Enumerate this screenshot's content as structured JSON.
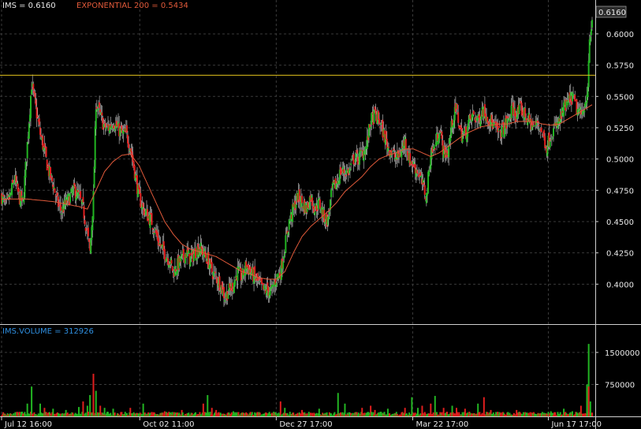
{
  "colors": {
    "background": "#000000",
    "grid": "#3a3a3a",
    "frame": "#d0d0d0",
    "up": "#22b422",
    "down": "#e01e1e",
    "ema": "#e25a3a",
    "resistance": "#e2c21c",
    "price_label": "#e8e8e8",
    "ema_label": "#e25a3a",
    "volume_label": "#2f8fe0"
  },
  "chart_data": [
    {
      "type": "candlestick",
      "labels": {
        "price": "IMS = 0.6160",
        "ema": "EXPONENTIAL 200 = 0.5434",
        "last_price_box": "0.6160"
      },
      "ylim": [
        0.375,
        0.6195
      ],
      "y_ticks": [
        "0.4000",
        "0.4250",
        "0.4500",
        "0.4750",
        "0.5000",
        "0.5250",
        "0.5500",
        "0.5750",
        "0.6000"
      ],
      "x_ticks": [
        "Jul 12 16:00",
        "Oct 02 11:00",
        "Dec 27 17:00",
        "Mar 22 17:00",
        "Jun 17 17:00"
      ],
      "resistance_level": 0.567,
      "price_series": {
        "name": "IMS",
        "close_path": [
          [
            0,
            0.47
          ],
          [
            5,
            0.462
          ],
          [
            10,
            0.47
          ],
          [
            15,
            0.485
          ],
          [
            20,
            0.47
          ],
          [
            25,
            0.465
          ],
          [
            30,
            0.512
          ],
          [
            35,
            0.56
          ],
          [
            40,
            0.54
          ],
          [
            45,
            0.52
          ],
          [
            50,
            0.505
          ],
          [
            55,
            0.49
          ],
          [
            60,
            0.48
          ],
          [
            65,
            0.465
          ],
          [
            70,
            0.458
          ],
          [
            75,
            0.465
          ],
          [
            80,
            0.47
          ],
          [
            85,
            0.475
          ],
          [
            90,
            0.47
          ],
          [
            95,
            0.46
          ],
          [
            100,
            0.44
          ],
          [
            103,
            0.425
          ],
          [
            107,
            0.47
          ],
          [
            110,
            0.545
          ],
          [
            115,
            0.535
          ],
          [
            120,
            0.525
          ],
          [
            125,
            0.525
          ],
          [
            130,
            0.53
          ],
          [
            135,
            0.525
          ],
          [
            140,
            0.52
          ],
          [
            145,
            0.52
          ],
          [
            150,
            0.51
          ],
          [
            155,
            0.49
          ],
          [
            160,
            0.47
          ],
          [
            165,
            0.46
          ],
          [
            170,
            0.455
          ],
          [
            175,
            0.45
          ],
          [
            180,
            0.44
          ],
          [
            185,
            0.43
          ],
          [
            190,
            0.425
          ],
          [
            195,
            0.42
          ],
          [
            200,
            0.41
          ],
          [
            205,
            0.415
          ],
          [
            210,
            0.42
          ],
          [
            215,
            0.425
          ],
          [
            220,
            0.42
          ],
          [
            225,
            0.425
          ],
          [
            230,
            0.43
          ],
          [
            235,
            0.425
          ],
          [
            240,
            0.42
          ],
          [
            245,
            0.41
          ],
          [
            250,
            0.405
          ],
          [
            255,
            0.4
          ],
          [
            260,
            0.39
          ],
          [
            265,
            0.395
          ],
          [
            270,
            0.4
          ],
          [
            275,
            0.41
          ],
          [
            280,
            0.405
          ],
          [
            285,
            0.415
          ],
          [
            290,
            0.41
          ],
          [
            295,
            0.405
          ],
          [
            300,
            0.4
          ],
          [
            305,
            0.395
          ],
          [
            310,
            0.395
          ],
          [
            315,
            0.395
          ],
          [
            320,
            0.405
          ],
          [
            325,
            0.41
          ],
          [
            330,
            0.43
          ],
          [
            335,
            0.45
          ],
          [
            340,
            0.46
          ],
          [
            345,
            0.47
          ],
          [
            350,
            0.465
          ],
          [
            355,
            0.46
          ],
          [
            360,
            0.47
          ],
          [
            365,
            0.46
          ],
          [
            370,
            0.465
          ],
          [
            375,
            0.455
          ],
          [
            380,
            0.45
          ],
          [
            385,
            0.475
          ],
          [
            390,
            0.48
          ],
          [
            395,
            0.49
          ],
          [
            400,
            0.49
          ],
          [
            405,
            0.49
          ],
          [
            410,
            0.5
          ],
          [
            415,
            0.5
          ],
          [
            420,
            0.505
          ],
          [
            425,
            0.51
          ],
          [
            430,
            0.53
          ],
          [
            435,
            0.535
          ],
          [
            440,
            0.53
          ],
          [
            445,
            0.52
          ],
          [
            450,
            0.51
          ],
          [
            455,
            0.505
          ],
          [
            460,
            0.5
          ],
          [
            465,
            0.505
          ],
          [
            470,
            0.515
          ],
          [
            475,
            0.5
          ],
          [
            480,
            0.495
          ],
          [
            485,
            0.49
          ],
          [
            490,
            0.48
          ],
          [
            495,
            0.47
          ],
          [
            500,
            0.505
          ],
          [
            505,
            0.51
          ],
          [
            510,
            0.525
          ],
          [
            515,
            0.505
          ],
          [
            520,
            0.505
          ],
          [
            525,
            0.53
          ],
          [
            530,
            0.54
          ],
          [
            535,
            0.52
          ],
          [
            540,
            0.52
          ],
          [
            545,
            0.53
          ],
          [
            550,
            0.535
          ],
          [
            555,
            0.53
          ],
          [
            560,
            0.54
          ],
          [
            565,
            0.535
          ],
          [
            570,
            0.53
          ],
          [
            575,
            0.525
          ],
          [
            580,
            0.52
          ],
          [
            585,
            0.525
          ],
          [
            590,
            0.53
          ],
          [
            595,
            0.54
          ],
          [
            600,
            0.535
          ],
          [
            605,
            0.54
          ],
          [
            610,
            0.535
          ],
          [
            615,
            0.53
          ],
          [
            620,
            0.525
          ],
          [
            625,
            0.53
          ],
          [
            630,
            0.52
          ],
          [
            635,
            0.51
          ],
          [
            640,
            0.52
          ],
          [
            645,
            0.525
          ],
          [
            650,
            0.53
          ],
          [
            655,
            0.54
          ],
          [
            660,
            0.545
          ],
          [
            665,
            0.55
          ],
          [
            670,
            0.54
          ],
          [
            675,
            0.535
          ],
          [
            680,
            0.545
          ],
          [
            683,
            0.56
          ],
          [
            685,
            0.59
          ],
          [
            688,
            0.612
          ]
        ]
      },
      "ema_series": {
        "name": "EXPONENTIAL 200",
        "path": [
          [
            0,
            0.468
          ],
          [
            30,
            0.468
          ],
          [
            60,
            0.466
          ],
          [
            90,
            0.462
          ],
          [
            100,
            0.46
          ],
          [
            110,
            0.475
          ],
          [
            120,
            0.49
          ],
          [
            130,
            0.498
          ],
          [
            140,
            0.503
          ],
          [
            150,
            0.504
          ],
          [
            160,
            0.495
          ],
          [
            170,
            0.48
          ],
          [
            180,
            0.465
          ],
          [
            190,
            0.45
          ],
          [
            200,
            0.44
          ],
          [
            210,
            0.432
          ],
          [
            220,
            0.428
          ],
          [
            230,
            0.426
          ],
          [
            240,
            0.424
          ],
          [
            250,
            0.422
          ],
          [
            260,
            0.418
          ],
          [
            270,
            0.414
          ],
          [
            280,
            0.41
          ],
          [
            290,
            0.408
          ],
          [
            300,
            0.405
          ],
          [
            310,
            0.404
          ],
          [
            320,
            0.404
          ],
          [
            330,
            0.41
          ],
          [
            340,
            0.425
          ],
          [
            350,
            0.438
          ],
          [
            360,
            0.446
          ],
          [
            370,
            0.452
          ],
          [
            380,
            0.458
          ],
          [
            390,
            0.465
          ],
          [
            400,
            0.474
          ],
          [
            410,
            0.48
          ],
          [
            420,
            0.486
          ],
          [
            430,
            0.494
          ],
          [
            440,
            0.5
          ],
          [
            450,
            0.503
          ],
          [
            460,
            0.505
          ],
          [
            470,
            0.508
          ],
          [
            480,
            0.508
          ],
          [
            490,
            0.505
          ],
          [
            500,
            0.502
          ],
          [
            510,
            0.505
          ],
          [
            520,
            0.51
          ],
          [
            530,
            0.515
          ],
          [
            540,
            0.52
          ],
          [
            550,
            0.523
          ],
          [
            560,
            0.526
          ],
          [
            570,
            0.527
          ],
          [
            580,
            0.528
          ],
          [
            590,
            0.528
          ],
          [
            600,
            0.53
          ],
          [
            610,
            0.53
          ],
          [
            620,
            0.53
          ],
          [
            630,
            0.528
          ],
          [
            640,
            0.527
          ],
          [
            650,
            0.528
          ],
          [
            660,
            0.532
          ],
          [
            670,
            0.536
          ],
          [
            680,
            0.54
          ],
          [
            688,
            0.5434
          ]
        ]
      }
    },
    {
      "type": "bar",
      "labels": {
        "volume": "IMS.VOLUME = 312926"
      },
      "ylim": [
        0,
        1850000
      ],
      "y_ticks": [
        "750000",
        "1500000"
      ],
      "spikes": [
        [
          30,
          300000
        ],
        [
          35,
          700000
        ],
        [
          45,
          300000
        ],
        [
          50,
          200000
        ],
        [
          60,
          180000
        ],
        [
          75,
          150000
        ],
        [
          90,
          220000
        ],
        [
          95,
          350000
        ],
        [
          100,
          250000
        ],
        [
          103,
          500000
        ],
        [
          107,
          1000000
        ],
        [
          110,
          600000
        ],
        [
          115,
          250000
        ],
        [
          120,
          200000
        ],
        [
          130,
          180000
        ],
        [
          150,
          200000
        ],
        [
          165,
          300000
        ],
        [
          190,
          120000
        ],
        [
          210,
          150000
        ],
        [
          235,
          300000
        ],
        [
          240,
          500000
        ],
        [
          245,
          200000
        ],
        [
          250,
          150000
        ],
        [
          270,
          120000
        ],
        [
          300,
          100000
        ],
        [
          325,
          350000
        ],
        [
          330,
          200000
        ],
        [
          350,
          150000
        ],
        [
          370,
          180000
        ],
        [
          392,
          550000
        ],
        [
          400,
          300000
        ],
        [
          420,
          200000
        ],
        [
          430,
          250000
        ],
        [
          435,
          150000
        ],
        [
          450,
          180000
        ],
        [
          470,
          200000
        ],
        [
          478,
          450000
        ],
        [
          485,
          200000
        ],
        [
          490,
          250000
        ],
        [
          500,
          300000
        ],
        [
          505,
          480000
        ],
        [
          515,
          200000
        ],
        [
          525,
          250000
        ],
        [
          530,
          200000
        ],
        [
          540,
          180000
        ],
        [
          555,
          300000
        ],
        [
          562,
          450000
        ],
        [
          570,
          150000
        ],
        [
          580,
          100000
        ],
        [
          600,
          150000
        ],
        [
          620,
          100000
        ],
        [
          640,
          120000
        ],
        [
          655,
          180000
        ],
        [
          665,
          120000
        ],
        [
          675,
          250000
        ],
        [
          682,
          750000
        ],
        [
          684,
          1700000
        ],
        [
          686,
          350000
        ]
      ]
    }
  ]
}
